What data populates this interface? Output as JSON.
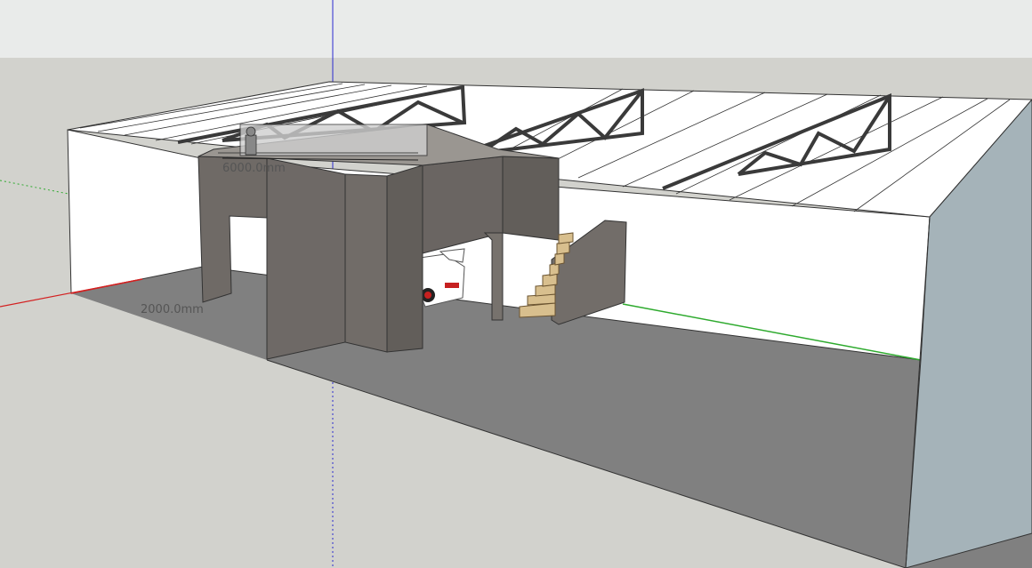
{
  "colors": {
    "sky": "#e9ebea",
    "ground": "#d2d2cd",
    "floor": "#808080",
    "wall_white": "#ffffff",
    "wall_right_side": "#a5b3b9",
    "concrete": "#6f6a66",
    "truss": "#3a3a3a",
    "axis_red": "#d32020",
    "axis_green": "#2eaa2e",
    "axis_blue": "#2a2ad0",
    "stairs": "#d8bf8e"
  },
  "dimensions": {
    "width_label": "2000.0mm",
    "depth_label": "6000.0mm"
  }
}
